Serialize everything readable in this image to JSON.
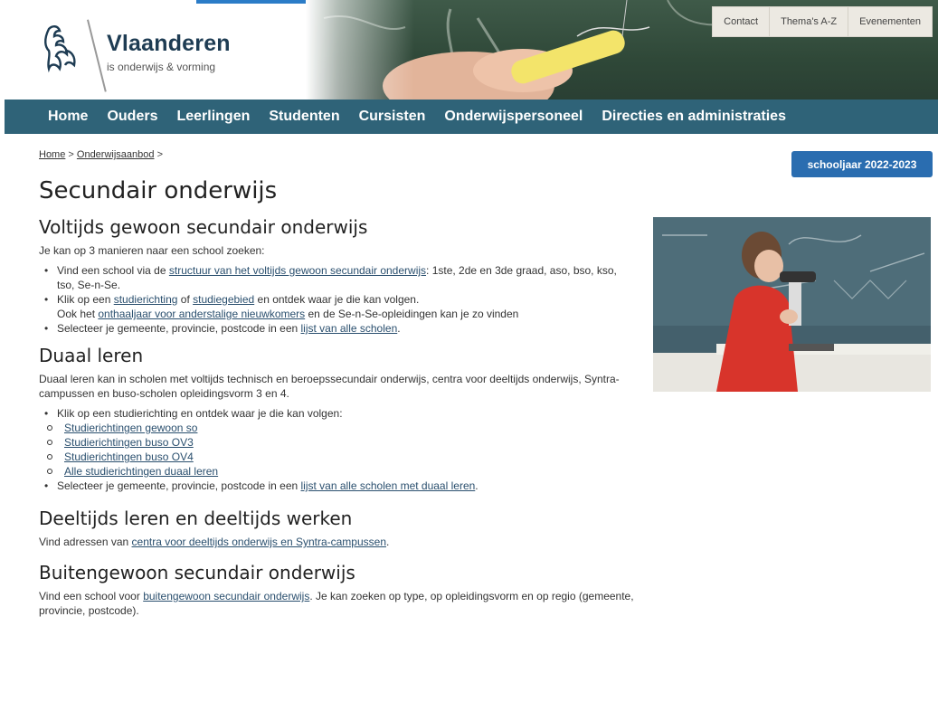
{
  "header": {
    "logo_title": "Vlaanderen",
    "logo_subtitle": "is onderwijs & vorming",
    "top_links": [
      "Contact",
      "Thema's A-Z",
      "Evenementen"
    ]
  },
  "nav": {
    "items": [
      "Home",
      "Ouders",
      "Leerlingen",
      "Studenten",
      "Cursisten",
      "Onderwijspersoneel",
      "Directies en administraties"
    ]
  },
  "breadcrumb": {
    "home": "Home",
    "sep1": " > ",
    "onderwijsaanbod": "Onderwijsaanbod",
    "sep2": " >"
  },
  "school_year_button": "schooljaar 2022-2023",
  "page_title": "Secundair onderwijs",
  "sections": {
    "voltijds": {
      "heading": "Voltijds gewoon secundair onderwijs",
      "intro": "Je kan op 3 manieren naar een school zoeken:",
      "b1_pre": "Vind een school via de ",
      "b1_link": "structuur van het voltijds gewoon secundair onderwijs",
      "b1_post": ": 1ste, 2de en 3de graad, aso, bso, kso, tso, Se-n-Se.",
      "b2_pre": "Klik op een ",
      "b2_link1": "studierichting",
      "b2_mid": " of ",
      "b2_link2": "studiegebied",
      "b2_post": " en ontdek waar je die kan volgen.",
      "b2_line2_pre": "Ook het ",
      "b2_line2_link": "onthaaljaar voor anderstalige nieuwkomers",
      "b2_line2_post": " en de Se-n-Se-opleidingen kan je zo vinden",
      "b3_pre": "Selecteer je gemeente, provincie, postcode in een ",
      "b3_link": "lijst van alle scholen",
      "b3_post": "."
    },
    "duaal": {
      "heading": "Duaal leren",
      "intro": "Duaal leren kan in scholen met voltijds technisch en beroepssecundair onderwijs, centra voor deeltijds onderwijs, Syntra-campussen en buso-scholen opleidingsvorm 3 en 4.",
      "b1": "Klik op een studierichting en ontdek waar je die kan volgen:",
      "sub": [
        "Studierichtingen gewoon so",
        "Studierichtingen buso OV3",
        "Studierichtingen buso OV4",
        "Alle studierichtingen duaal leren"
      ],
      "b2_pre": "Selecteer je gemeente, provincie, postcode in een ",
      "b2_link": "lijst van alle scholen met duaal leren",
      "b2_post": "."
    },
    "deeltijds": {
      "heading": "Deeltijds leren en deeltijds werken",
      "pre": "Vind adressen van ",
      "link": "centra voor deeltijds onderwijs en Syntra-campussen",
      "post": "."
    },
    "buitengewoon": {
      "heading": "Buitengewoon secundair onderwijs",
      "pre": "Vind een school voor ",
      "link": "buitengewoon secundair onderwijs",
      "post": ". Je kan zoeken op type, op opleidingsvorm en op regio (gemeente, provincie, postcode)."
    }
  }
}
